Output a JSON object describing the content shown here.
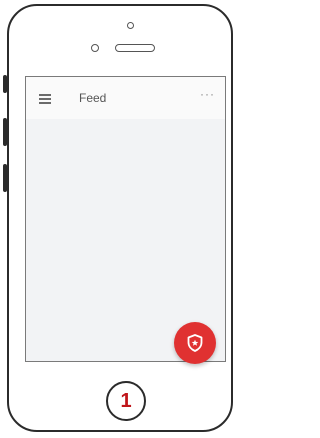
{
  "app": {
    "title": "Feed",
    "menu_icon": "hamburger-menu-icon",
    "overflow_icon": "more-horizontal-icon",
    "overflow_glyph": "···"
  },
  "fab": {
    "icon": "shield-star-icon",
    "color": "#e03131"
  },
  "annotation": {
    "number": "1",
    "color": "#c0151a"
  }
}
